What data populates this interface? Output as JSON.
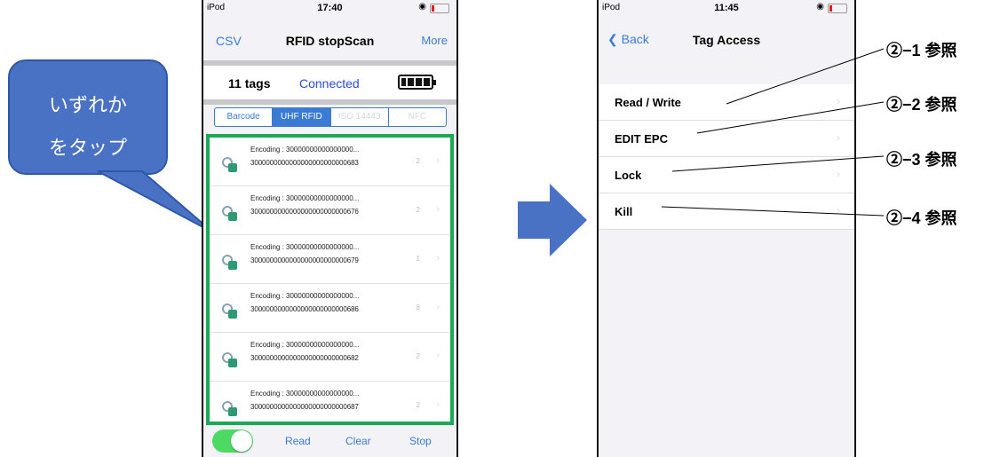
{
  "phone1": {
    "status": {
      "carrier": "iPod",
      "time": "17:40"
    },
    "nav": {
      "left": "CSV",
      "title": "RFID stopScan",
      "right": "More"
    },
    "tag_count": "11 tags",
    "connection": "Connected",
    "segments": [
      "Barcode",
      "UHF RFID",
      "ISO 14443",
      "NFC"
    ],
    "rows": [
      {
        "encoding": "Encoding : 30000000000000000...",
        "id": "3000000000000000000000000683",
        "count": "2"
      },
      {
        "encoding": "Encoding : 30000000000000000...",
        "id": "3000000000000000000000000676",
        "count": "2"
      },
      {
        "encoding": "Encoding : 30000000000000000...",
        "id": "3000000000000000000000000679",
        "count": "1"
      },
      {
        "encoding": "Encoding : 30000000000000000...",
        "id": "3000000000000000000000000686",
        "count": "8"
      },
      {
        "encoding": "Encoding : 30000000000000000...",
        "id": "3000000000000000000000000682",
        "count": "2"
      },
      {
        "encoding": "Encoding : 30000000000000000...",
        "id": "3000000000000000000000000687",
        "count": "2"
      }
    ],
    "bottom": {
      "read": "Read",
      "clear": "Clear",
      "stop": "Stop"
    }
  },
  "callout": {
    "line1": "いずれか",
    "line2": "をタップ"
  },
  "phone2": {
    "status": {
      "carrier": "iPod",
      "time": "11:45"
    },
    "nav": {
      "back": "Back",
      "title": "Tag Access"
    },
    "items": [
      "Read / Write",
      "EDIT EPC",
      "Lock",
      "Kill"
    ]
  },
  "annotations": [
    "②−1 参照",
    "②−2 参照",
    "②−3 参照",
    "②−4 参照"
  ],
  "colors": {
    "accent": "#3a7bd5",
    "highlight": "#1aaa55",
    "callout": "#4a72c4",
    "toggle": "#4cd964"
  }
}
